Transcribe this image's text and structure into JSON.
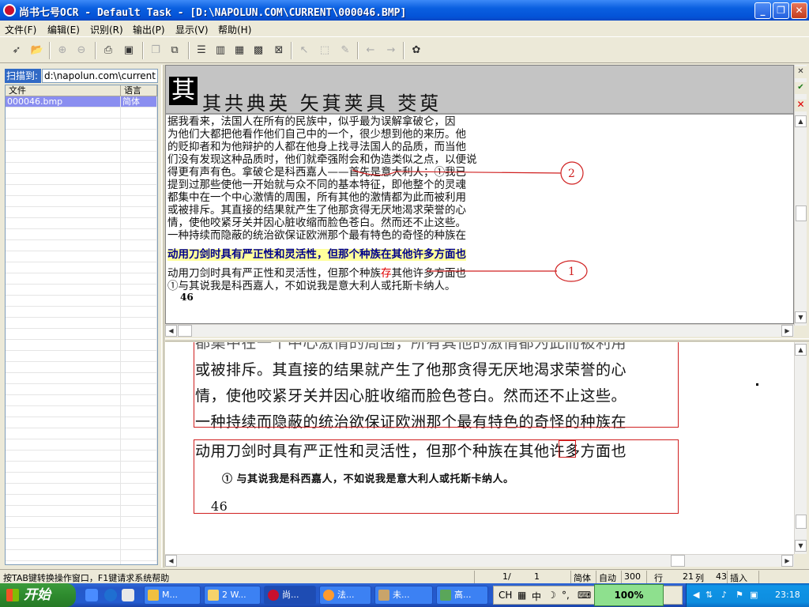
{
  "window": {
    "title": "尚书七号OCR - Default Task - [D:\\NAPOLUN.COM\\CURRENT\\000046.BMP]"
  },
  "menu": [
    {
      "label": "文件(F)"
    },
    {
      "label": "编辑(E)"
    },
    {
      "label": "识别(R)"
    },
    {
      "label": "输出(P)"
    },
    {
      "label": "显示(V)"
    },
    {
      "label": "帮助(H)"
    }
  ],
  "left_panel": {
    "scan_label": "扫描到:",
    "scan_path": "d:\\napolun.com\\current",
    "columns": [
      "文件",
      "语言"
    ],
    "files": [
      {
        "name": "000046.bmp",
        "lang": "简体"
      }
    ]
  },
  "candidates": {
    "selected_char": "其",
    "list": "其共典英 矢萁荚具 茭萸"
  },
  "recognized_lines": [
    "    据我看来，法国人在所有的民族中，似乎最为误解拿破仑，因",
    "为他们大都把他看作他们自己中的一个，很少想到他的来历。他",
    "的贬抑者和为他辩护的人都在他身上找寻法国人的品质，而当他",
    "们没有发现这种品质时，他们就牵强附会和伪造类似之点，以便说",
    "得更有声有色。拿破仑是科西嘉人——首先是意大利人；①我已",
    "提到过那些使他一开始就与众不同的基本特征，即他整个的灵魂",
    "都集中在一个中心激情的周围，所有其他的激情都为此而被利用",
    "或被排斥。其直接的结果就产生了他那贪得无厌地渴求荣誉的心",
    "情，使他咬紧牙关并因心脏收缩而脸色苍白。然而还不止这些。",
    "一种持续而隐蔽的统治欲保证欧洲那个最有特色的奇怪的种族在"
  ],
  "highlight_line": "动用刀剑时具有严正性和灵活性，但那个种族在其他许多方面也",
  "corrected_line": {
    "before": "动用刀剑时具有严正性和灵活性，但那个种族",
    "mark": "存",
    "after": "其他许多方面也"
  },
  "footnote_line": "    ①与其说我是科西嘉人，不如说我是意大利人或托斯卡纳人。",
  "page_number": "46",
  "annotations": {
    "circle_2": "2",
    "circle_1": "1"
  },
  "image_lines": [
    "或被排斥。其直接的结果就产生了他那贪得无厌地渴求荣誉的心",
    "情，使他咬紧牙关并因心脏收缩而脸色苍白。然而还不止这些。",
    "一种持续而隐蔽的统治欲保证欧洲那个最有特色的奇怪的种族在",
    "动用刀剑时具有严正性和灵活性，但那个种族在其他许多方面也"
  ],
  "image_footnote": "①   与其说我是科西嘉人，不如说我是意大利人或托斯卡纳人。",
  "image_page": "46",
  "status": {
    "hint": "按TAB键转换操作窗口，F1键请求系统帮助",
    "page": "1/",
    "page2": "1",
    "lang": "简体",
    "mode": "自动",
    "dpi": "300",
    "row_label": "行",
    "row": "21",
    "col_label": "列",
    "col": "43",
    "insert": "插入"
  },
  "taskbar": {
    "start": "开始",
    "tasks": [
      "M...",
      "2 W...",
      "尚...",
      "法...",
      "未...",
      "高..."
    ],
    "ime_lang": "CH",
    "ime_mode": "中",
    "zoom": "100%",
    "clock": "23:18"
  },
  "colors": {
    "accent": "#316ac5",
    "highlight": "#ffff9c",
    "mark": "#e00000",
    "selection": "#8a8ef0"
  }
}
